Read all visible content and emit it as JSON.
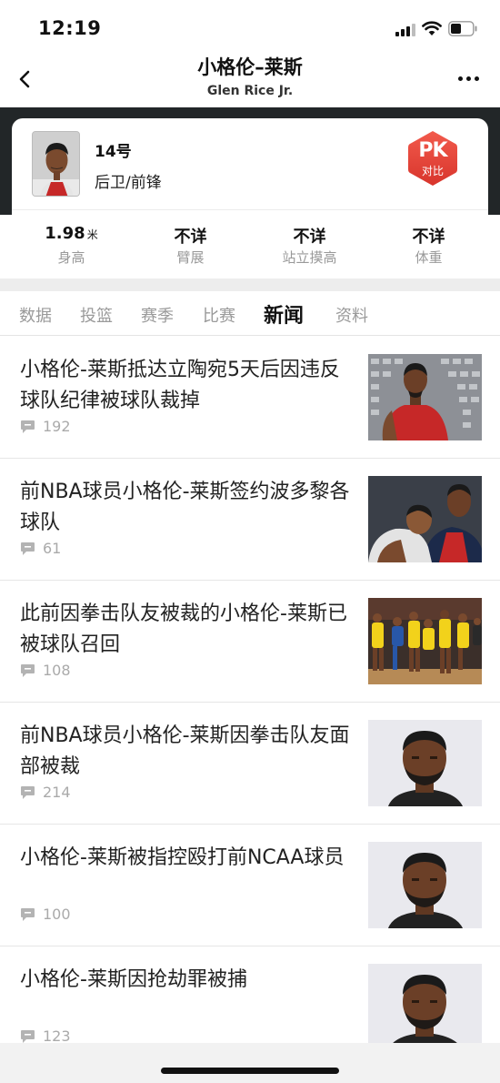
{
  "status_bar": {
    "time": "12:19"
  },
  "header": {
    "title": "小格伦–莱斯",
    "subtitle": "Glen Rice Jr.",
    "back_icon": "chevron-left-icon",
    "more_icon": "more-dots-icon"
  },
  "player": {
    "number": "14号",
    "position": "后卫/前锋",
    "pk_badge": {
      "main": "PK",
      "sub": "对比",
      "color": "#e8453c"
    },
    "stats": [
      {
        "value": "1.98",
        "unit": "米",
        "label": "身高"
      },
      {
        "value": "不详",
        "unit": "",
        "label": "臂展"
      },
      {
        "value": "不详",
        "unit": "",
        "label": "站立摸高"
      },
      {
        "value": "不详",
        "unit": "",
        "label": "体重"
      }
    ]
  },
  "tabs": [
    {
      "label": "数据",
      "active": false
    },
    {
      "label": "投篮",
      "active": false
    },
    {
      "label": "赛季",
      "active": false
    },
    {
      "label": "比赛",
      "active": false
    },
    {
      "label": "新闻",
      "active": true
    },
    {
      "label": "资料",
      "active": false
    }
  ],
  "news": [
    {
      "title": "小格伦-莱斯抵达立陶宛5天后因违反球队纪律被球队裁掉",
      "comments": "192",
      "thumb": "player-red-jersey-photo"
    },
    {
      "title": "前NBA球员小格伦-莱斯签约波多黎各球队",
      "comments": "61",
      "thumb": "players-huddle-photo"
    },
    {
      "title": "此前因拳击队友被裁的小格伦-莱斯已被球队召回",
      "comments": "108",
      "thumb": "yellow-team-game-photo"
    },
    {
      "title": "前NBA球员小格伦-莱斯因拳击队友面部被裁",
      "comments": "214",
      "thumb": "mugshot-photo"
    },
    {
      "title": "小格伦-莱斯被指控殴打前NCAA球员",
      "comments": "100",
      "thumb": "mugshot-photo"
    },
    {
      "title": "小格伦-莱斯因抢劫罪被捕",
      "comments": "123",
      "thumb": "mugshot-photo"
    }
  ],
  "colors": {
    "dark_band": "#222628",
    "accent": "#e8453c",
    "tab_inactive": "#9a9a9a"
  }
}
